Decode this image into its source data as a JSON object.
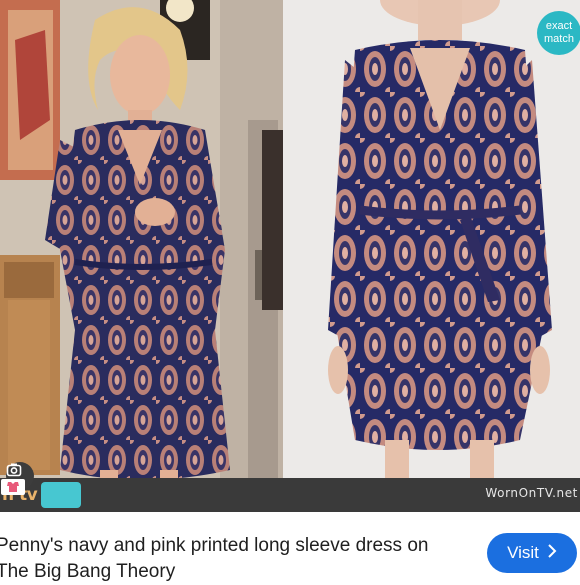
{
  "badge": {
    "line1": "exact",
    "line2": "match"
  },
  "watermark": {
    "left_text": "n tv",
    "right_text": "WornOnTV.net"
  },
  "caption": {
    "text": "Penny's navy and pink printed long sleeve dress on The Big Bang Theory"
  },
  "visit_button": {
    "label": "Visit",
    "icon": "chevron-right-icon"
  },
  "icons": {
    "lens": "google-lens-icon",
    "tv": "tv-logo-icon"
  },
  "colors": {
    "accent": "#1b6fe0",
    "badge": "#2bb8c4",
    "dress_navy": "#24285a",
    "dress_pink": "#c98d83"
  }
}
